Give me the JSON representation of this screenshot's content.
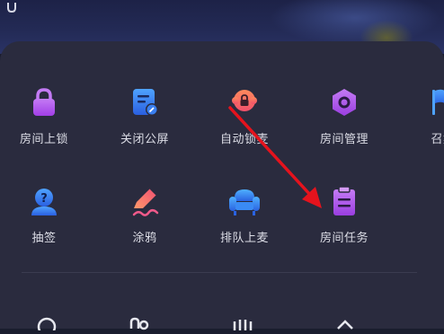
{
  "panel": {
    "items": [
      {
        "label": "房间上锁",
        "icon": "lock-icon"
      },
      {
        "label": "关闭公屏",
        "icon": "screen-edit-icon"
      },
      {
        "label": "自动锁麦",
        "icon": "mic-lock-icon"
      },
      {
        "label": "房间管理",
        "icon": "hexagon-settings-icon"
      },
      {
        "label": "召集",
        "icon": "flag-icon"
      },
      {
        "label": "抽签",
        "icon": "question-person-icon"
      },
      {
        "label": "涂鸦",
        "icon": "pencil-scribble-icon"
      },
      {
        "label": "排队上麦",
        "icon": "sofa-icon"
      },
      {
        "label": "房间任务",
        "icon": "clipboard-icon"
      }
    ]
  },
  "colors": {
    "purple": "#b45af2",
    "blue": "#3a7ff0",
    "pink": "#f05a6e",
    "annotation_red": "#e5131d"
  }
}
